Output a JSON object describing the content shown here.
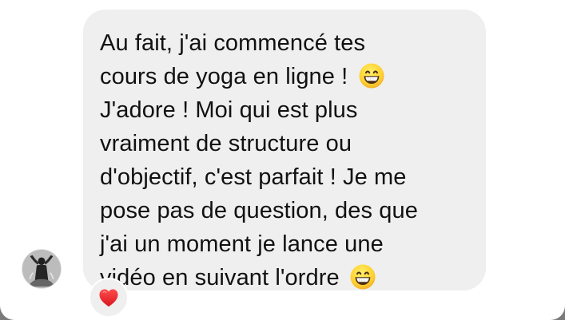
{
  "message": {
    "lines": [
      {
        "text": "Au fait, j'ai commencé tes"
      },
      {
        "text": "cours de yoga en ligne !",
        "emoji": "grinning-face-emoji"
      },
      {
        "text": "J'adore ! Moi qui est plus"
      },
      {
        "text": "vraiment de structure ou"
      },
      {
        "text": "d'objectif, c'est parfait ! Je me"
      },
      {
        "text": "pose pas de question, des que"
      },
      {
        "text": "j'ai un moment je lance une"
      },
      {
        "text": "vidéo en suivant l'ordre",
        "emoji": "grinning-face-emoji"
      }
    ]
  },
  "avatar": {
    "icon": "yoga-pose-avatar"
  },
  "reaction": {
    "icon": "red-heart-icon",
    "color": "#e0262f"
  },
  "colors": {
    "bubble": "#efefef",
    "text": "#111111",
    "background": "#ffffff"
  }
}
